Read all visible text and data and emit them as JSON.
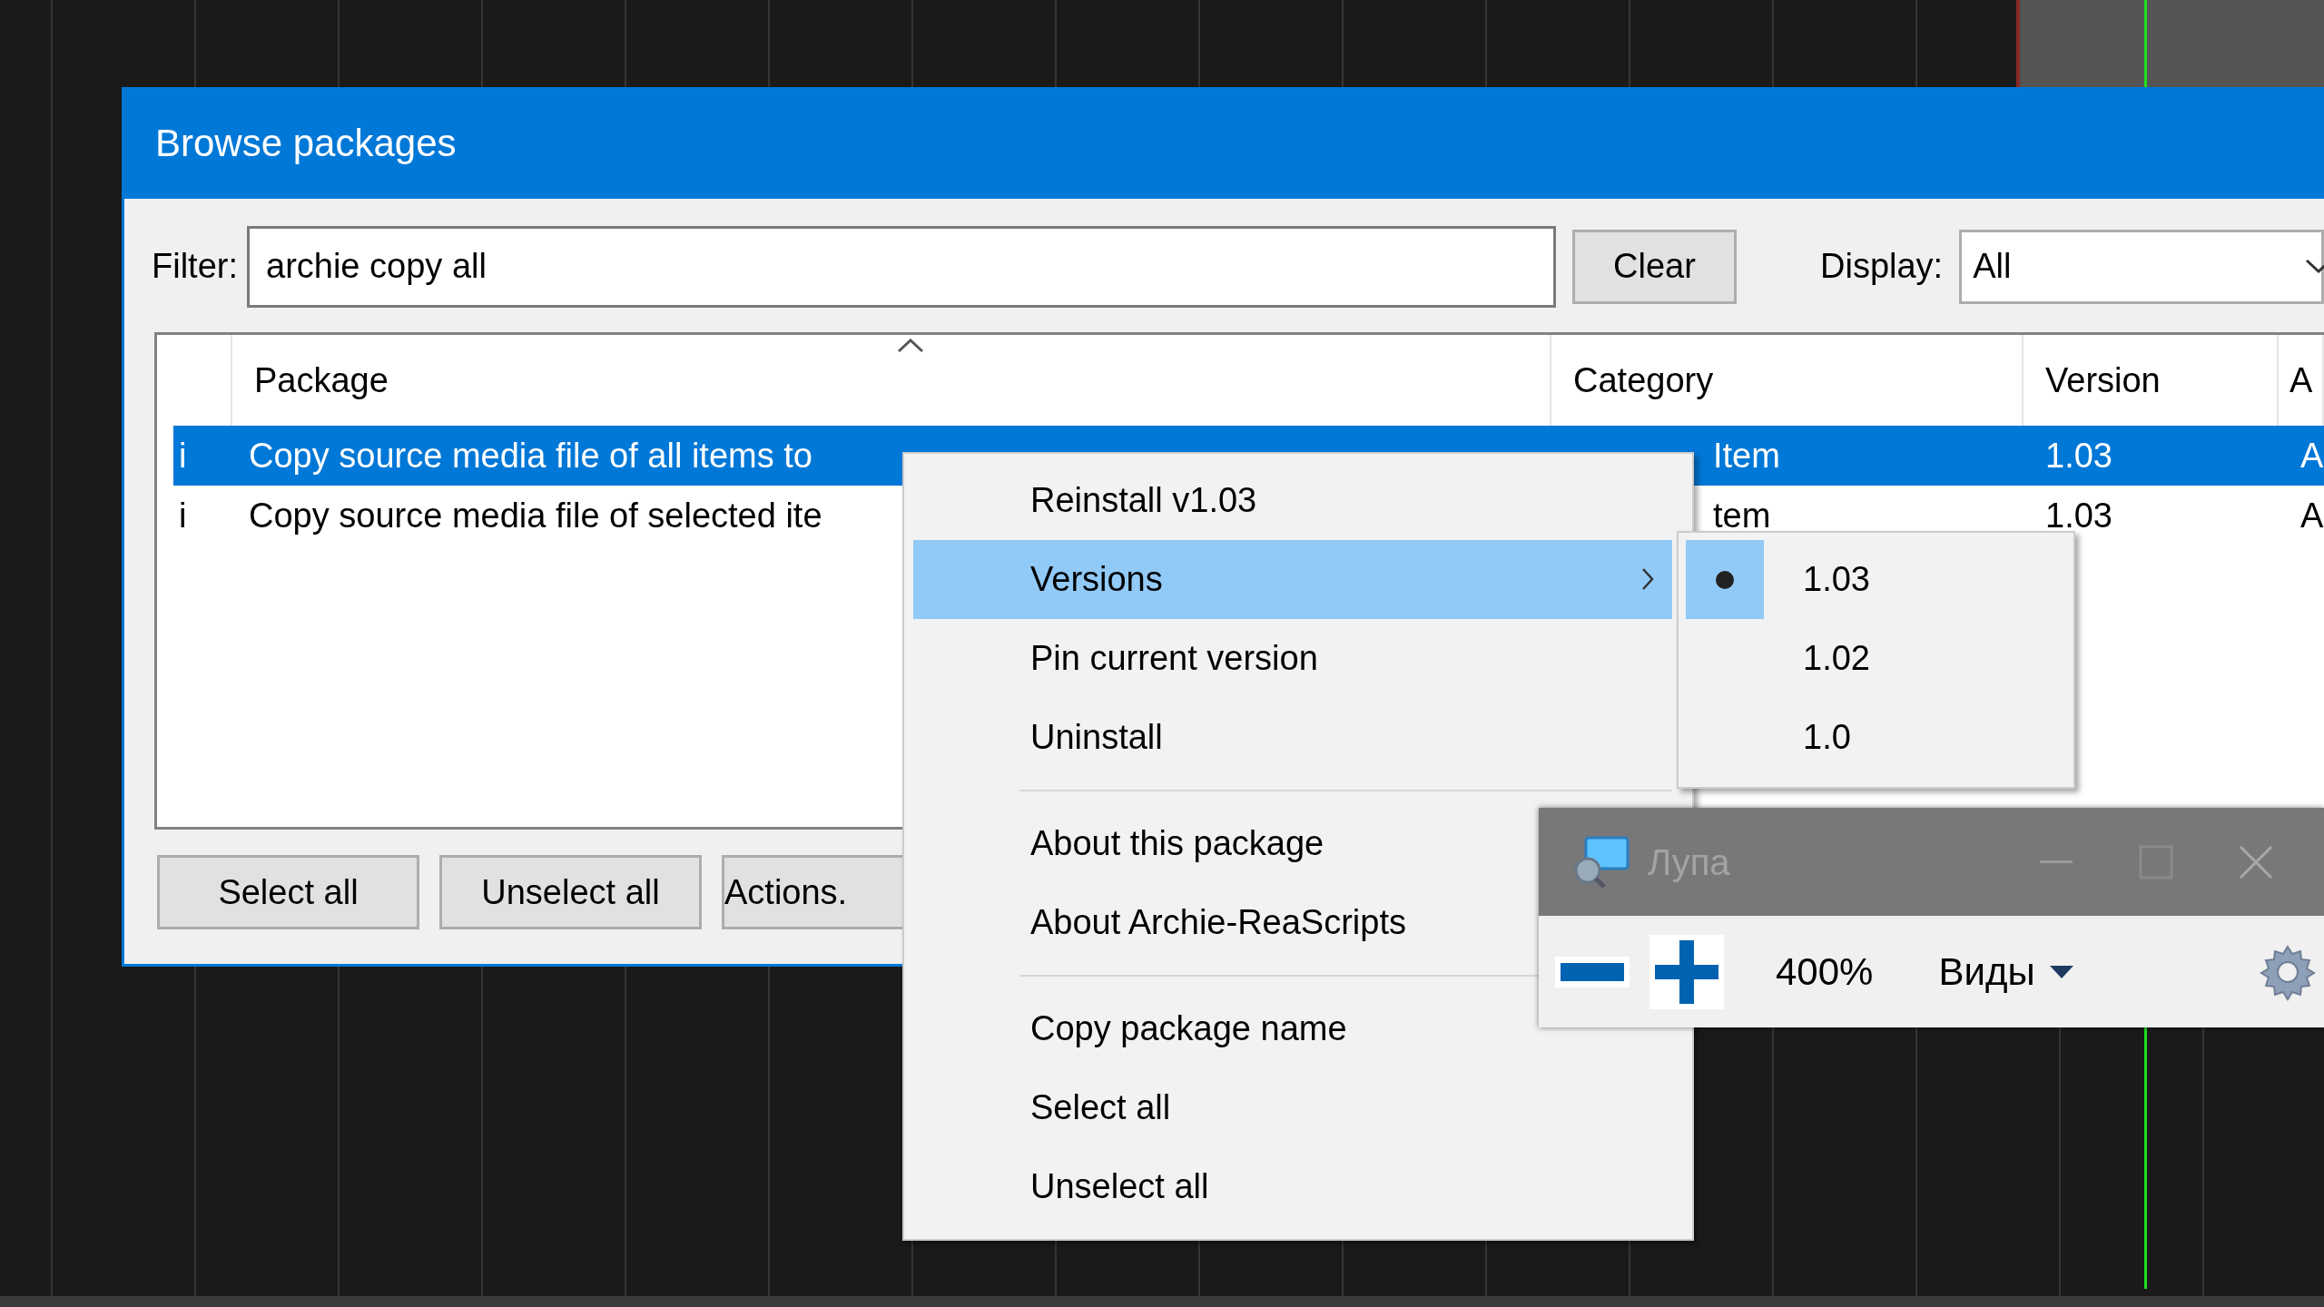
{
  "dialog": {
    "title": "Browse packages",
    "filter": {
      "label": "Filter:",
      "value": "archie copy all"
    },
    "clear_button": "Clear",
    "display": {
      "label": "Display:",
      "value": "All"
    },
    "table": {
      "columns": [
        "",
        "Package",
        "Category",
        "Version",
        "A"
      ],
      "rows": [
        {
          "column_1": "i",
          "package": "Copy source media file of all items to",
          "category": "Item",
          "version": "1.03",
          "column_5": "A",
          "selected": true
        },
        {
          "column_1": "i",
          "package": "Copy source media file of selected ite",
          "category": "tem",
          "version": "1.03",
          "column_5": "A",
          "selected": false
        }
      ]
    },
    "buttons": [
      "Select all",
      "Unselect all",
      "Actions."
    ]
  },
  "context_menu": {
    "items": [
      {
        "kind": "item",
        "label": "Reinstall v1.03",
        "selected": false,
        "submenu": false
      },
      {
        "kind": "item",
        "label": "Versions",
        "selected": true,
        "submenu": true
      },
      {
        "kind": "item",
        "label": "Pin current version",
        "selected": false,
        "submenu": false
      },
      {
        "kind": "item",
        "label": "Uninstall",
        "selected": false,
        "submenu": false
      },
      {
        "kind": "separator"
      },
      {
        "kind": "item",
        "label": "About this package",
        "selected": false,
        "submenu": false
      },
      {
        "kind": "item",
        "label": "About Archie-ReaScripts",
        "selected": false,
        "submenu": false
      },
      {
        "kind": "separator"
      },
      {
        "kind": "item",
        "label": "Copy package name",
        "selected": false,
        "submenu": false
      },
      {
        "kind": "item",
        "label": "Select all",
        "selected": false,
        "submenu": false
      },
      {
        "kind": "item",
        "label": "Unselect all",
        "selected": false,
        "submenu": false
      }
    ]
  },
  "versions_submenu": {
    "items": [
      {
        "label": "1.03",
        "checked": true
      },
      {
        "label": "1.02",
        "checked": false
      },
      {
        "label": "1.0",
        "checked": false
      }
    ]
  },
  "magnifier": {
    "title": "Лупа",
    "zoom": "400%",
    "views": "Виды"
  }
}
